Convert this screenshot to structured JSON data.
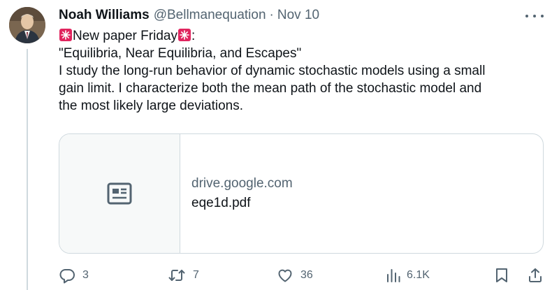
{
  "tweet": {
    "author_name": "Noah Williams",
    "handle": "@Bellmanequation",
    "separator": "·",
    "date": "Nov 10",
    "text_line1": "New paper Friday",
    "text_line1_suffix": ":",
    "text_line2": "\"Equilibria, Near Equilibria, and Escapes\"",
    "text_line3": "I study the long-run behavior of dynamic stochastic models using a small",
    "text_line4": "gain limit. I characterize both the mean path of the stochastic model and",
    "text_line5": "the most likely large deviations."
  },
  "card": {
    "domain": "drive.google.com",
    "title": "eqe1d.pdf",
    "icon": "newspaper-icon"
  },
  "actions": {
    "replies": "3",
    "retweets": "7",
    "likes": "36",
    "views": "6.1K"
  },
  "colors": {
    "text_primary": "#0f1419",
    "text_secondary": "#536471",
    "border": "#cfd9de",
    "siren_red": "#e0245e"
  }
}
